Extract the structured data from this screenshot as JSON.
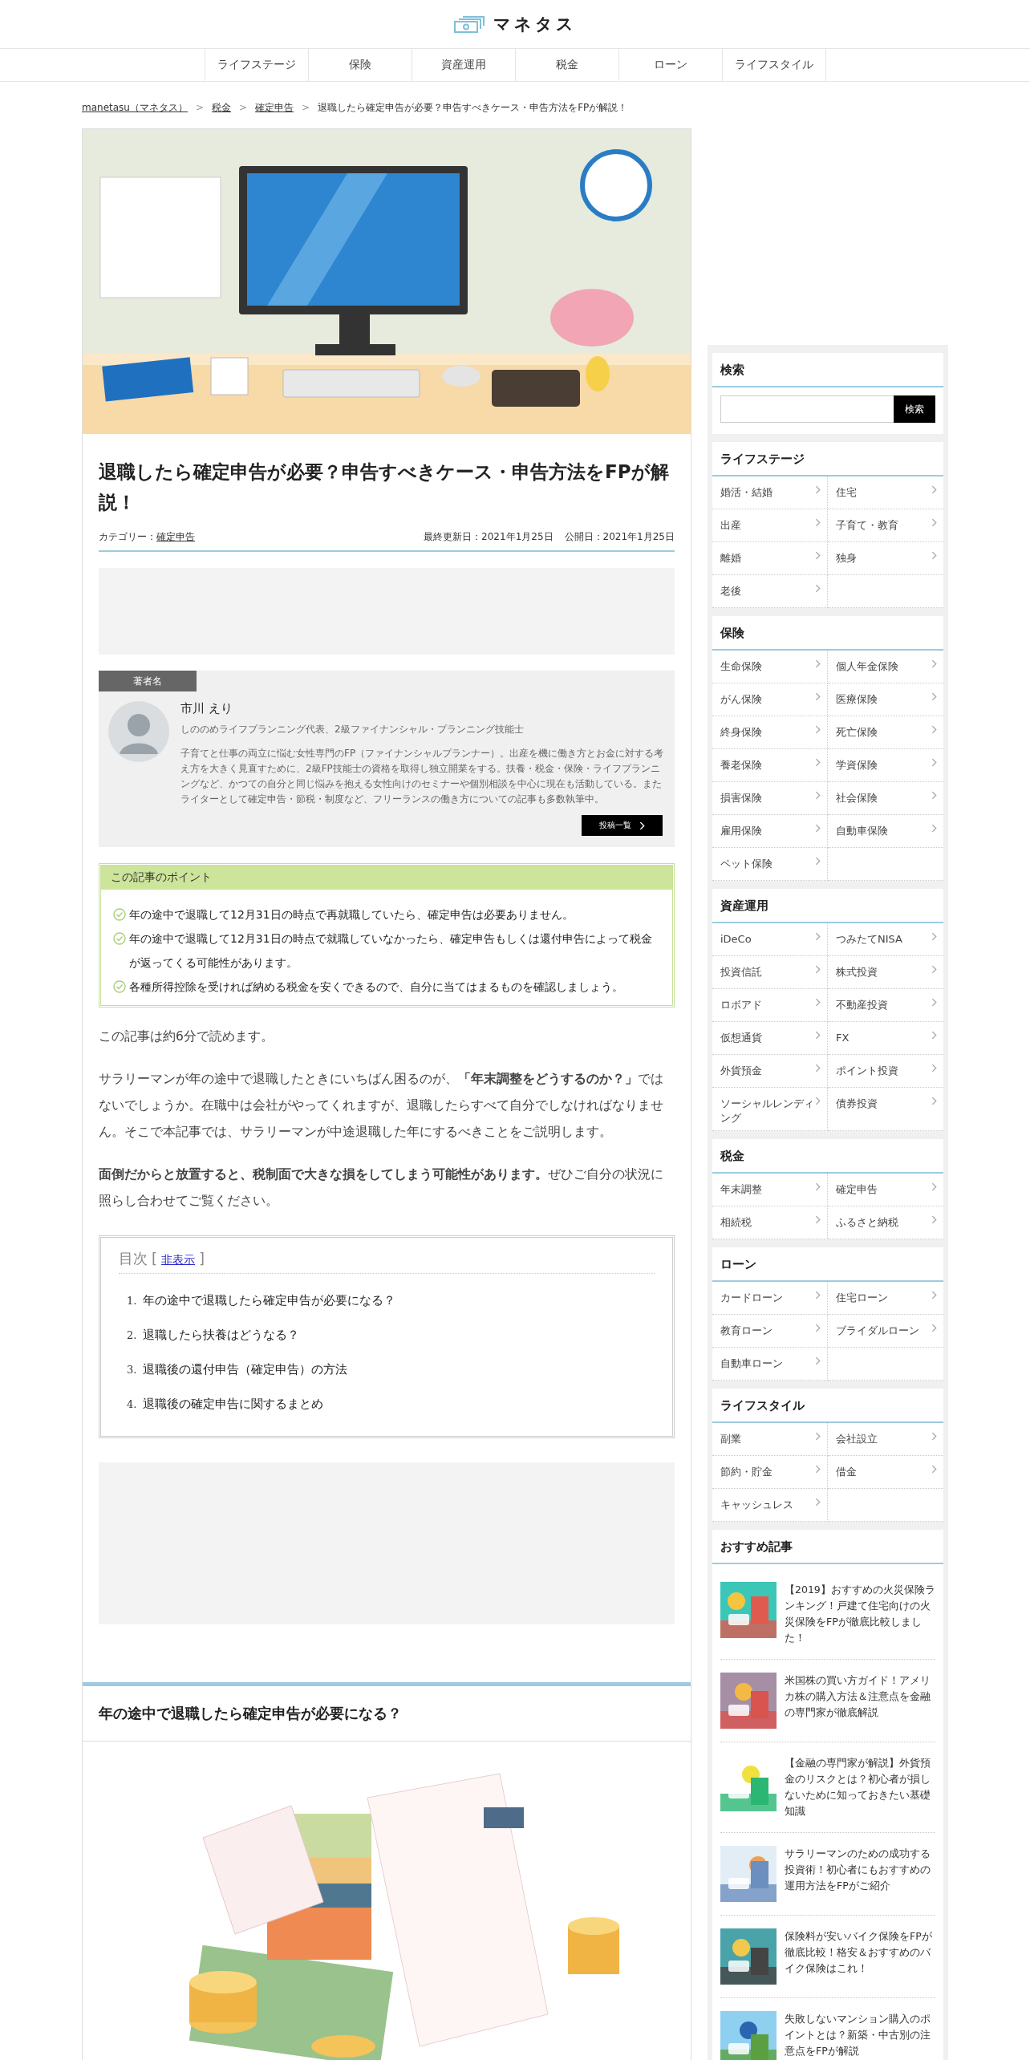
{
  "header": {
    "logo": "マネタス"
  },
  "nav": [
    {
      "label": "ライフステージ"
    },
    {
      "label": "保険"
    },
    {
      "label": "資産運用"
    },
    {
      "label": "税金"
    },
    {
      "label": "ローン"
    },
    {
      "label": "ライフスタイル"
    }
  ],
  "breadcrumb": {
    "separator": ">",
    "items": [
      {
        "label": "manetasu（マネタス）",
        "link": true
      },
      {
        "label": "税金",
        "link": true
      },
      {
        "label": "確定申告",
        "link": true
      },
      {
        "label": "退職したら確定申告が必要？申告すべきケース・申告方法をFPが解説！",
        "link": false
      }
    ]
  },
  "article": {
    "title": "退職したら確定申告が必要？申告すべきケース・申告方法をFPが解説！",
    "category_label": "カテゴリー：",
    "category": "確定申告",
    "updated": "最終更新日：2021年1月25日",
    "published": "公開日：2021年1月25日",
    "author": {
      "heading": "著者名",
      "name": "市川 えり",
      "role": "しののめライフプランニング代表、2級ファイナンシャル・プランニング技能士",
      "bio": "子育てと仕事の両立に悩む女性専門のFP（ファイナンシャルプランナー）。出産を機に働き方とお金に対する考え方を大きく見直すために、2級FP技能士の資格を取得し独立開業をする。扶養・税金・保険・ライフプランニングなど、かつての自分と同じ悩みを抱える女性向けのセミナーや個別相談を中心に現在も活動している。またライターとして確定申告・節税・制度など、フリーランスの働き方についての記事も多数執筆中。",
      "button": "投稿一覧"
    },
    "points": {
      "title": "この記事のポイント",
      "items": [
        "年の途中で退職して12月31日の時点で再就職していたら、確定申告は必要ありません。",
        "年の途中で退職して12月31日の時点で就職していなかったら、確定申告もしくは還付申告によって税金が返ってくる可能性があります。",
        "各種所得控除を受ければ納める税金を安くできるので、自分に当てはまるものを確認しましょう。"
      ]
    },
    "paragraphs": [
      "この記事は約6分で読めます。",
      "サラリーマンが年の途中で退職したときにいちばん困るのが、**「年末調整をどうするのか？」**ではないでしょうか。在職中は会社がやってくれますが、退職したらすべて自分でしなければなりません。そこで本記事では、サラリーマンが中途退職した年にするべきことをご説明します。",
      "**面倒だからと放置すると、税制面で大きな損をしてしまう可能性があります。**ぜひご自分の状況に照らし合わせてご覧ください。"
    ],
    "toc": {
      "title": "目次",
      "bracket_open": "[",
      "toggle": "非表示",
      "bracket_close": "]",
      "items": [
        {
          "number": "1.",
          "label": "年の途中で退職したら確定申告が必要になる？"
        },
        {
          "number": "2.",
          "label": "退職したら扶養はどうなる？"
        },
        {
          "number": "3.",
          "label": "退職後の還付申告（確定申告）の方法"
        },
        {
          "number": "4.",
          "label": "退職後の確定申告に関するまとめ"
        }
      ]
    },
    "section_heading": "年の途中で退職したら確定申告が必要になる？"
  },
  "sidebar": {
    "search": {
      "title": "検索",
      "button": "検索"
    },
    "categories": [
      {
        "title": "ライフステージ",
        "items": [
          "婚活・結婚",
          "住宅",
          "出産",
          "子育て・教育",
          "離婚",
          "独身",
          "老後"
        ]
      },
      {
        "title": "保険",
        "items": [
          "生命保険",
          "個人年金保険",
          "がん保険",
          "医療保険",
          "終身保険",
          "死亡保険",
          "養老保険",
          "学資保険",
          "損害保険",
          "社会保険",
          "雇用保険",
          "自動車保険",
          "ペット保険"
        ]
      },
      {
        "title": "資産運用",
        "items": [
          "iDeCo",
          "つみたてNISA",
          "投資信託",
          "株式投資",
          "ロボアド",
          "不動産投資",
          "仮想通貨",
          "FX",
          "外貨預金",
          "ポイント投資",
          "ソーシャルレンディング",
          "債券投資"
        ]
      },
      {
        "title": "税金",
        "items": [
          "年末調整",
          "確定申告",
          "相続税",
          "ふるさと納税"
        ]
      },
      {
        "title": "ローン",
        "items": [
          "カードローン",
          "住宅ローン",
          "教育ローン",
          "ブライダルローン",
          "自動車ローン"
        ]
      },
      {
        "title": "ライフスタイル",
        "items": [
          "副業",
          "会社設立",
          "節約・貯金",
          "借金",
          "キャッシュレス"
        ]
      }
    ],
    "recommended": {
      "title": "おすすめ記事",
      "items": [
        {
          "title": "【2019】おすすめの火災保険ランキング！戸建て住宅向けの火災保険をFPが徹底比較しました！"
        },
        {
          "title": "米国株の買い方ガイド！アメリカ株の購入方法＆注意点を金融の専門家が徹底解説"
        },
        {
          "title": "【金融の専門家が解説】外貨預金のリスクとは？初心者が損しないために知っておきたい基礎知識"
        },
        {
          "title": "サラリーマンのための成功する投資術！初心者にもおすすめの運用方法をFPがご紹介"
        },
        {
          "title": "保険料が安いバイク保険をFPが徹底比較！格安＆おすすめのバイク保険はこれ！"
        },
        {
          "title": "失敗しないマンション購入のポイントとは？新築・中古別の注意点をFPが解説"
        }
      ]
    }
  }
}
